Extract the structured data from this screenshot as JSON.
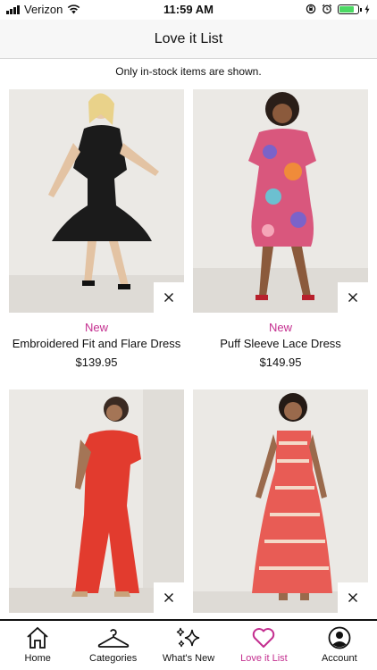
{
  "status_bar": {
    "carrier": "Verizon",
    "time": "11:59 AM"
  },
  "nav": {
    "title": "Love it List"
  },
  "notice": "Only in-stock items are shown.",
  "products": [
    {
      "badge": "New",
      "name": "Embroidered Fit and Flare Dress",
      "price": "$139.95",
      "dress_color": "#1b1b1b"
    },
    {
      "badge": "New",
      "name": "Puff Sleeve Lace Dress",
      "price": "$149.95",
      "dress_color": "#d9577d"
    },
    {
      "dress_color": "#e23b2e"
    },
    {
      "dress_color": "#e85c55"
    }
  ],
  "tabs": [
    {
      "label": "Home",
      "icon": "home-icon"
    },
    {
      "label": "Categories",
      "icon": "hanger-icon"
    },
    {
      "label": "What's New",
      "icon": "sparkle-icon"
    },
    {
      "label": "Love it List",
      "icon": "heart-icon",
      "active": true
    },
    {
      "label": "Account",
      "icon": "account-icon"
    }
  ],
  "colors": {
    "accent": "#c42e8f",
    "nav_background": "#f7f7f7"
  }
}
